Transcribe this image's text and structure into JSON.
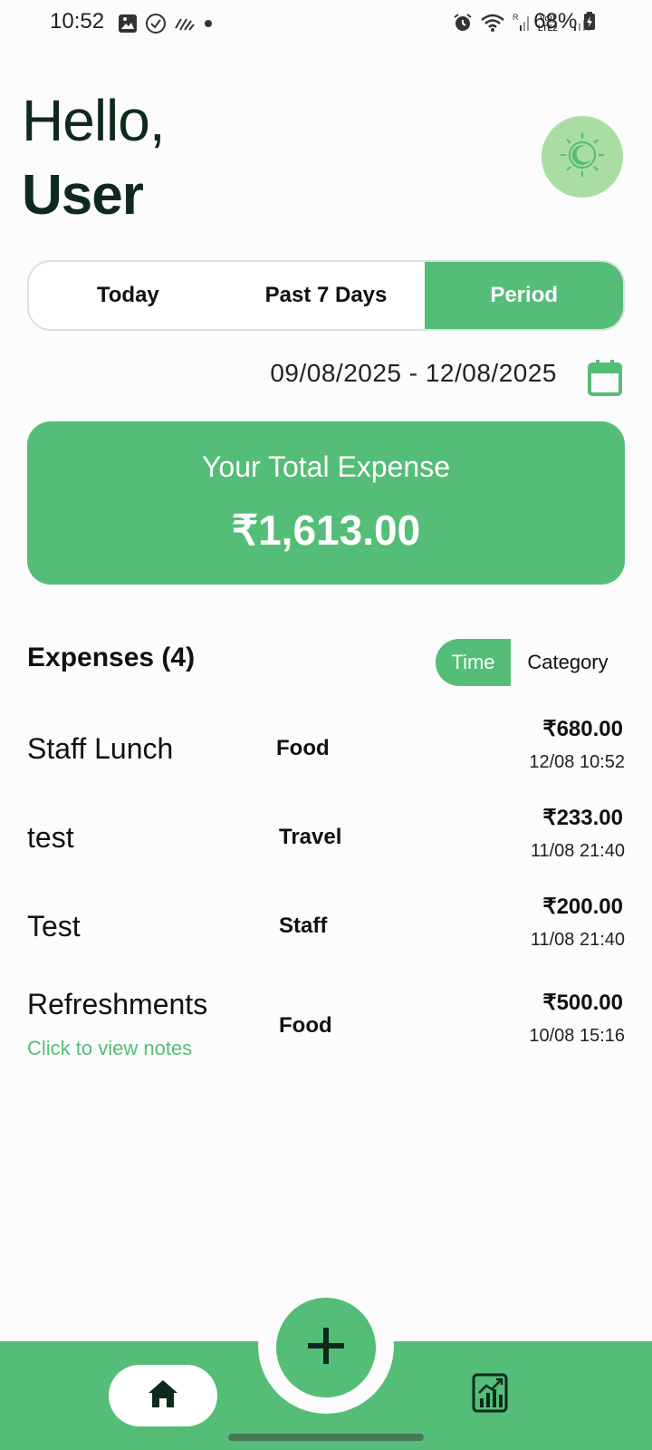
{
  "status_bar": {
    "time": "10:52",
    "battery": "68%",
    "left_icons": [
      "image-icon",
      "check-circle-icon",
      "signal-activity-icon",
      "dot-icon"
    ],
    "right_icons": [
      "alarm-icon",
      "wifi-icon",
      "signal-icon",
      "volte-icon",
      "signal-icon",
      "battery-icon"
    ]
  },
  "greeting": {
    "hello": "Hello,",
    "user": "User"
  },
  "theme_toggle": {
    "icon": "theme-sun-moon-icon"
  },
  "period_tabs": [
    {
      "label": "Today",
      "active": false
    },
    {
      "label": "Past 7 Days",
      "active": false
    },
    {
      "label": "Period",
      "active": true
    }
  ],
  "date_range": "09/08/2025 - 12/08/2025",
  "total": {
    "label": "Your Total Expense",
    "value": "₹1,613.00"
  },
  "expenses_header": "Expenses (4)",
  "sort": {
    "time": "Time",
    "category": "Category",
    "selected": "Time"
  },
  "expenses": [
    {
      "name": "Staff Lunch",
      "category": "Food",
      "amount": "₹680.00",
      "datetime": "12/08 10:52"
    },
    {
      "name": "test",
      "category": "Travel",
      "amount": "₹233.00",
      "datetime": "11/08 21:40"
    },
    {
      "name": "Test",
      "category": "Staff",
      "amount": "₹200.00",
      "datetime": "11/08 21:40"
    },
    {
      "name": "Refreshments",
      "category": "Food",
      "amount": "₹500.00",
      "datetime": "10/08 15:16",
      "notes_link": "Click to view notes"
    }
  ],
  "colors": {
    "accent": "#54bd77",
    "accent_light": "#a9dda4",
    "text_dark": "#0e2a1c"
  },
  "bottom_nav": {
    "home_icon": "home-icon",
    "add_icon": "plus-icon",
    "stats_icon": "stats-chart-icon"
  }
}
